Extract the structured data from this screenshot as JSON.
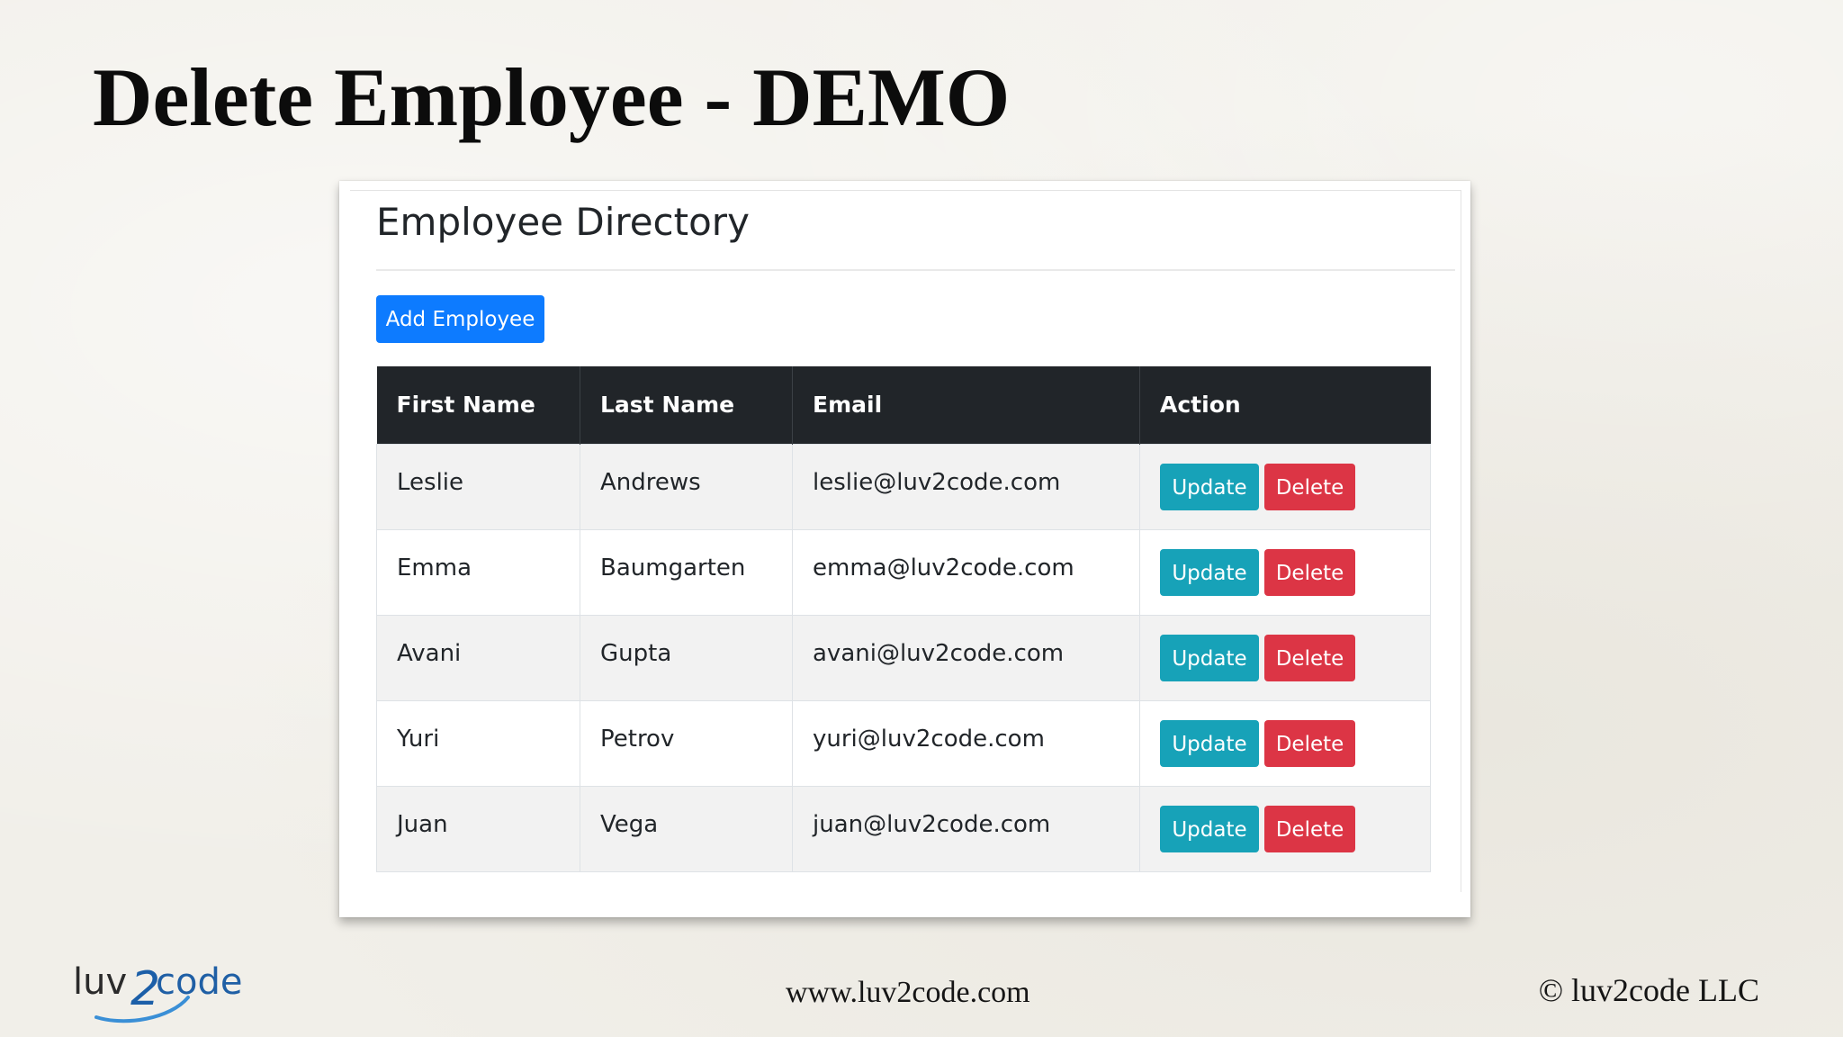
{
  "slide": {
    "title": "Delete Employee - DEMO"
  },
  "app": {
    "title": "Employee Directory",
    "add_button_label": "Add Employee",
    "table": {
      "columns": [
        "First Name",
        "Last Name",
        "Email",
        "Action"
      ],
      "rows": [
        {
          "first_name": "Leslie",
          "last_name": "Andrews",
          "email": "leslie@luv2code.com"
        },
        {
          "first_name": "Emma",
          "last_name": "Baumgarten",
          "email": "emma@luv2code.com"
        },
        {
          "first_name": "Avani",
          "last_name": "Gupta",
          "email": "avani@luv2code.com"
        },
        {
          "first_name": "Yuri",
          "last_name": "Petrov",
          "email": "yuri@luv2code.com"
        },
        {
          "first_name": "Juan",
          "last_name": "Vega",
          "email": "juan@luv2code.com"
        }
      ],
      "update_label": "Update",
      "delete_label": "Delete"
    },
    "colors": {
      "primary": "#0d7bff",
      "info": "#17a2b8",
      "danger": "#dc3545",
      "table_header": "#212529"
    }
  },
  "footer": {
    "logo_text_left": "luv",
    "logo_text_digit": "2",
    "logo_text_right": "code",
    "url": "www.luv2code.com",
    "copyright": "© luv2code LLC"
  }
}
